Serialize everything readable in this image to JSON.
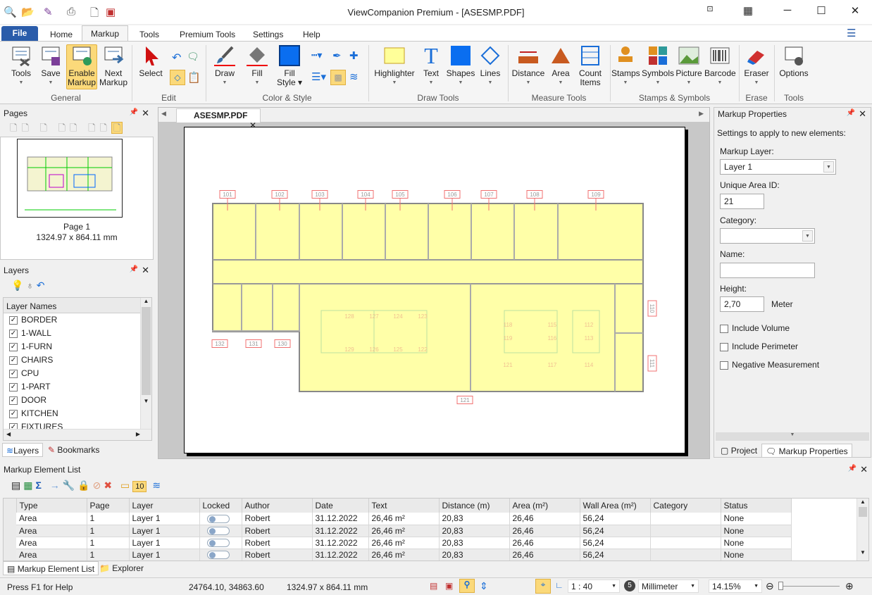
{
  "window": {
    "title": "ViewCompanion Premium - [ASESMP.PDF]"
  },
  "ribbon_tabs": [
    "File",
    "Home",
    "Markup",
    "Tools",
    "Premium Tools",
    "Settings",
    "Help"
  ],
  "ribbon": {
    "groups": [
      "General",
      "Edit",
      "Color & Style",
      "Draw Tools",
      "Measure Tools",
      "Stamps & Symbols",
      "Erase",
      "Tools"
    ],
    "buttons": {
      "tools": "Tools",
      "save": "Save",
      "enable1": "Enable",
      "enable2": "Markup",
      "next1": "Next",
      "next2": "Markup",
      "select": "Select",
      "draw": "Draw",
      "fill": "Fill",
      "fillstyle1": "Fill",
      "fillstyle2": "Style",
      "highlighter": "Highlighter",
      "text": "Text",
      "shapes": "Shapes",
      "lines": "Lines",
      "distance": "Distance",
      "area": "Area",
      "count1": "Count",
      "count2": "Items",
      "stamps": "Stamps",
      "symbols": "Symbols",
      "picture": "Picture",
      "barcode": "Barcode",
      "eraser": "Eraser",
      "options": "Options"
    },
    "accent": "#2a5caa"
  },
  "pages_panel": {
    "title": "Pages",
    "page_label": "Page 1",
    "page_size": "1324.97 x 864.11 mm"
  },
  "layers_panel": {
    "title": "Layers",
    "header": "Layer Names",
    "layers": [
      {
        "name": "BORDER",
        "checked": true
      },
      {
        "name": "1-WALL",
        "checked": true
      },
      {
        "name": "1-FURN",
        "checked": true
      },
      {
        "name": "CHAIRS",
        "checked": true
      },
      {
        "name": "CPU",
        "checked": true
      },
      {
        "name": "1-PART",
        "checked": true
      },
      {
        "name": "DOOR",
        "checked": true
      },
      {
        "name": "KITCHEN",
        "checked": true
      },
      {
        "name": "FIXTURES",
        "checked": true
      }
    ],
    "tabs": [
      "Layers",
      "Bookmarks"
    ]
  },
  "document": {
    "tab": "ASESMP.PDF",
    "room_tags_top": [
      "101",
      "102",
      "103",
      "104",
      "105",
      "106",
      "107",
      "108",
      "109"
    ],
    "room_tags_left": [
      "132",
      "131",
      "130"
    ],
    "room_tags_right": [
      "110",
      "111"
    ],
    "room_tag_bottom": "121",
    "inner_tags": [
      "128",
      "127",
      "124",
      "123",
      "129",
      "126",
      "125",
      "122",
      "118",
      "115",
      "112",
      "119",
      "116",
      "113",
      "121",
      "117",
      "114"
    ]
  },
  "markup_properties": {
    "title": "Markup Properties",
    "intro": "Settings to apply to new elements:",
    "layer_label": "Markup Layer:",
    "layer_value": "Layer 1",
    "area_id_label": "Unique Area ID:",
    "area_id_value": "21",
    "category_label": "Category:",
    "category_value": "",
    "name_label": "Name:",
    "name_value": "",
    "height_label": "Height:",
    "height_value": "2,70",
    "height_unit": "Meter",
    "include_volume": "Include Volume",
    "include_perimeter": "Include Perimeter",
    "negative": "Negative Measurement",
    "tabs": [
      "Project",
      "Markup Properties"
    ]
  },
  "element_list": {
    "title": "Markup Element List",
    "count_badge": "10",
    "columns": [
      "Type",
      "Page",
      "Layer",
      "Locked",
      "Author",
      "Date",
      "Text",
      "Distance (m)",
      "Area (m²)",
      "Wall Area (m²)",
      "Category",
      "Status"
    ],
    "rows": [
      [
        "Area",
        "1",
        "Layer 1",
        "",
        "Robert",
        "31.12.2022",
        "26,46 m²",
        "20,83",
        "26,46",
        "56,24",
        "",
        "None"
      ],
      [
        "Area",
        "1",
        "Layer 1",
        "",
        "Robert",
        "31.12.2022",
        "26,46 m²",
        "20,83",
        "26,46",
        "56,24",
        "",
        "None"
      ],
      [
        "Area",
        "1",
        "Layer 1",
        "",
        "Robert",
        "31.12.2022",
        "26,46 m²",
        "20,83",
        "26,46",
        "56,24",
        "",
        "None"
      ],
      [
        "Area",
        "1",
        "Layer 1",
        "",
        "Robert",
        "31.12.2022",
        "26,46 m²",
        "20,83",
        "26,46",
        "56,24",
        "",
        "None"
      ]
    ],
    "tabs": [
      "Markup Element List",
      "Explorer"
    ]
  },
  "status": {
    "help": "Press F1 for Help",
    "coords": "24764.10, 34863.60",
    "size": "1324.97 x 864.11 mm",
    "scale": "1 : 40",
    "unit": "Millimeter",
    "zoom": "14.15%"
  }
}
